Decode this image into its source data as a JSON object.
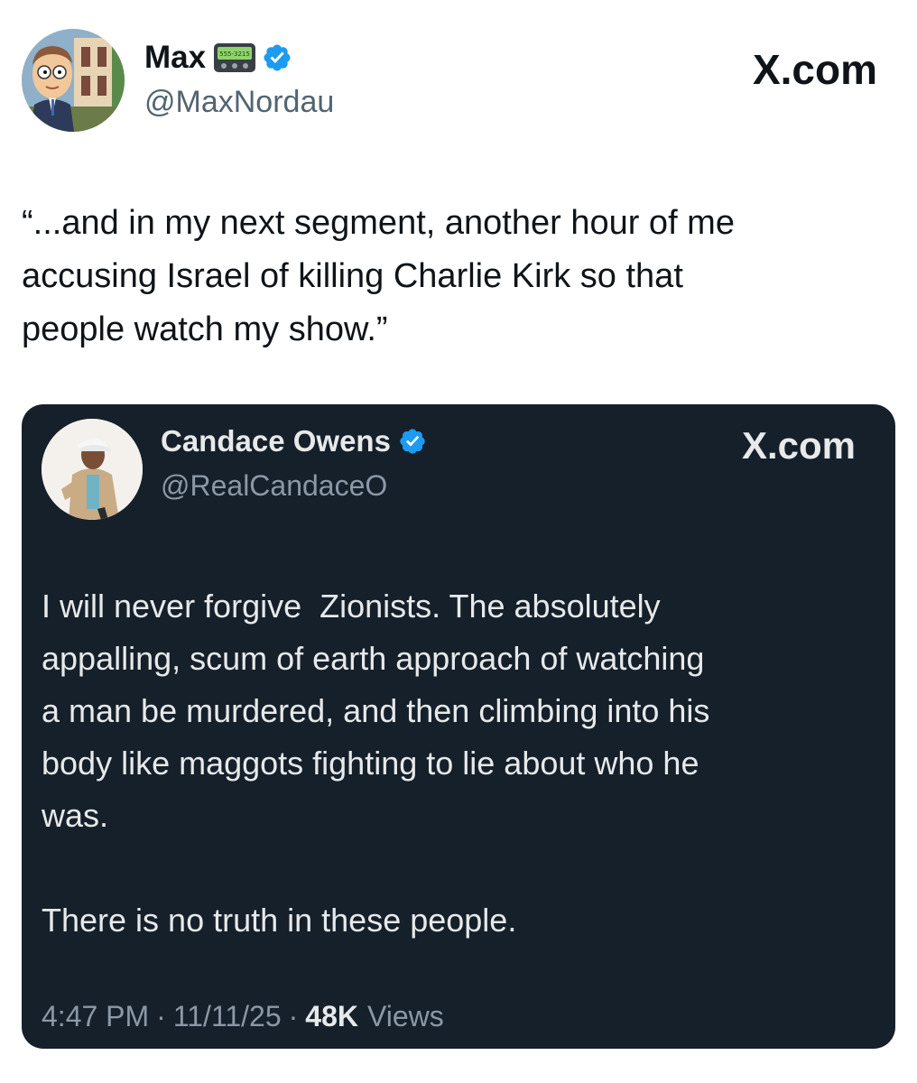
{
  "outer_tweet": {
    "display_name": "Max",
    "handle": "@MaxNordau",
    "platform": "X.com",
    "text": "“...and in my next segment, another hour of me\naccusing Israel of killing Charlie Kirk so that\npeople watch my show.”",
    "pager_text": "555-3215",
    "icons": {
      "badge": "verified-badge-icon",
      "pager": "pager-icon"
    }
  },
  "quoted_tweet": {
    "display_name": "Candace Owens",
    "handle": "@RealCandaceO",
    "platform": "X.com",
    "text": "I will never forgive  Zionists. The absolutely\nappalling, scum of earth approach of watching\na man be murdered, and then climbing into his\nbody like maggots fighting to lie about who he\nwas.\n\nThere is no truth in these people.",
    "time": "4:47 PM",
    "date": "11/11/25",
    "views_count": "48K",
    "views_label": "Views",
    "separator": "·",
    "icons": {
      "badge": "verified-badge-icon"
    }
  },
  "colors": {
    "verified_blue": "#1d9bf0",
    "card_background": "#15202b",
    "text_dark": "#0f1419",
    "text_light": "#e7e9ea",
    "secondary": "#536471"
  }
}
